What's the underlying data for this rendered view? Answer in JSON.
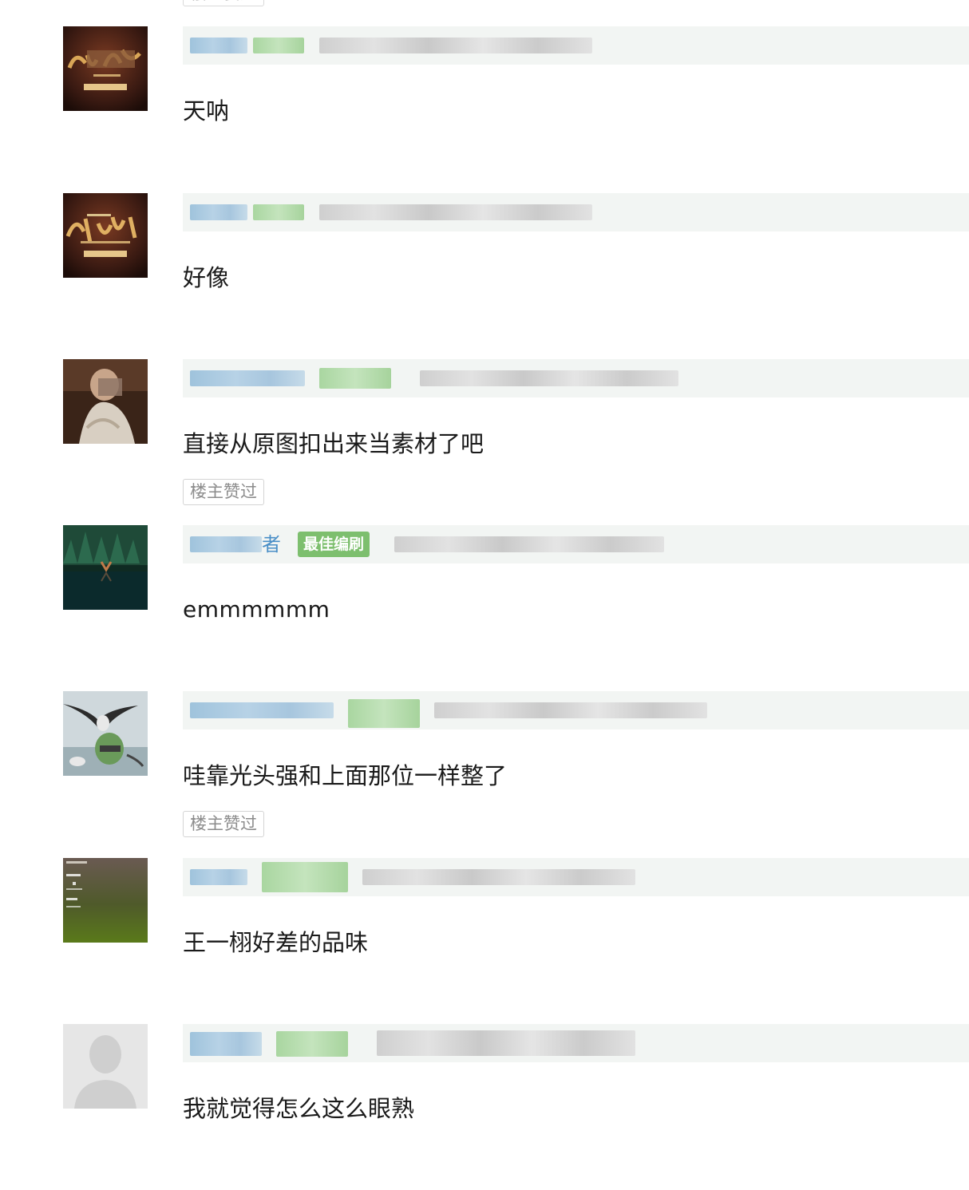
{
  "top_badge": "楼主赞过",
  "comments": [
    {
      "text": "天呐",
      "liked_by_op": false,
      "avatar": "poster-avatar"
    },
    {
      "text": "好像",
      "liked_by_op": false,
      "avatar": "poster-avatar"
    },
    {
      "text": "直接从原图扣出来当素材了吧",
      "liked_by_op": true,
      "like_label": "楼主赞过",
      "avatar": "portrait-avatar"
    },
    {
      "text": "emmmmmm",
      "liked_by_op": false,
      "name_suffix": "者",
      "badge": "最佳编刷",
      "avatar": "forest-avatar"
    },
    {
      "text": "哇靠光头强和上面那位一样整了",
      "liked_by_op": true,
      "like_label": "楼主赞过",
      "avatar": "bird-avatar"
    },
    {
      "text": "王一栩好差的品味",
      "liked_by_op": false,
      "avatar": "screen-avatar"
    },
    {
      "text": "我就觉得怎么这么眼熟",
      "liked_by_op": false,
      "avatar": "default-person-avatar"
    }
  ]
}
